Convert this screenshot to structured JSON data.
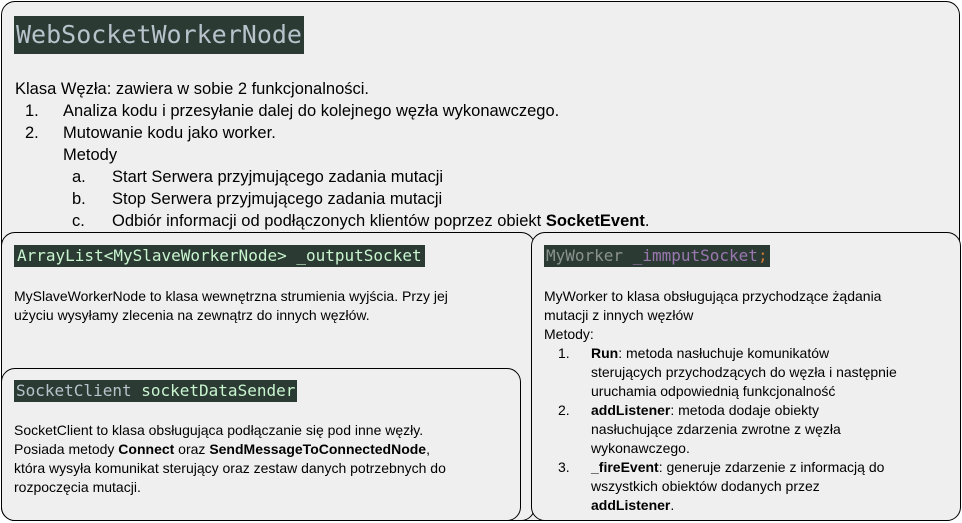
{
  "title": "WebSocketWorkerNode",
  "intro": {
    "heading": "Klasa Węzła: zawiera w sobie 2 funkcjonalności.",
    "items": [
      {
        "num": "1.",
        "text": "Analiza kodu i przesyłanie dalej do kolejnego węzła wykonawczego."
      },
      {
        "num": "2.",
        "text": "Mutowanie kodu jako worker."
      }
    ],
    "methods_label": "Metody",
    "methods": [
      {
        "num": "a.",
        "text": "Start Serwera przyjmującego zadania mutacji"
      },
      {
        "num": "b.",
        "text": "Stop Serwera przyjmującego zadania mutacji"
      },
      {
        "num": "c.",
        "text_before": "Odbiór informacji od podłączonych klientów poprzez obiekt ",
        "bold": "SocketEvent",
        "text_after": "."
      }
    ]
  },
  "output_socket": {
    "code_type": "ArrayList<MySlaveWorkerNode>",
    "code_name": "_outputSocket",
    "line1": "MySlaveWorkerNode to klasa wewnętrzna strumienia wyjścia. Przy jej",
    "line2": "użyciu wysyłamy zlecenia na zewnątrz do innych węzłów."
  },
  "socket_client": {
    "code_type": "SocketClient",
    "code_name": "socketDataSender",
    "line1": "SocketClient to klasa obsługująca podłączanie się pod inne węzły.",
    "line2_before": "Posiada metody ",
    "connect": "Connect",
    "line2_mid": " oraz ",
    "send": "SendMessageToConnectedNode",
    "line2_after": ",",
    "line3": "która wysyła komunikat sterujący oraz zestaw danych potrzebnych do",
    "line4": "rozpoczęcia mutacji."
  },
  "worker": {
    "code_type": "MyWorker",
    "code_name": "_immputSocket",
    "code_semicolon": ";",
    "line1": "MyWorker to klasa obsługująca przychodzące żądania",
    "line2": "mutacji z innych węzłów",
    "methods_label": "Metody:",
    "methods": [
      {
        "num": "1.",
        "bold": "Run",
        "l1": ": metoda nasłuchuje komunikatów",
        "l2": "sterujących przychodzących do węzła i następnie",
        "l3": "uruchamia odpowiednią funkcjonalność"
      },
      {
        "num": "2.",
        "bold": "addListener",
        "l1": ": metoda dodaje obiekty",
        "l2": "nasłuchujące zdarzenia zwrotne z węzła",
        "l3": "wykonawczego."
      },
      {
        "num": "3.",
        "bold": "_fireEvent",
        "l1": ": generuje zdarzenie z informacją do",
        "l2": "wszystkich obiektów dodanych przez",
        "l3_bold": "addListener",
        "l3_after": "."
      }
    ]
  },
  "colors": {
    "box_bg": "#efefef",
    "code_bg": "#2b3b34",
    "code_text": "#b8c2ca",
    "code_accent_green": "#c9f5cf",
    "code_purple": "#9b77b0",
    "code_muted": "#8a9290",
    "code_semicolon": "#cc7832"
  }
}
